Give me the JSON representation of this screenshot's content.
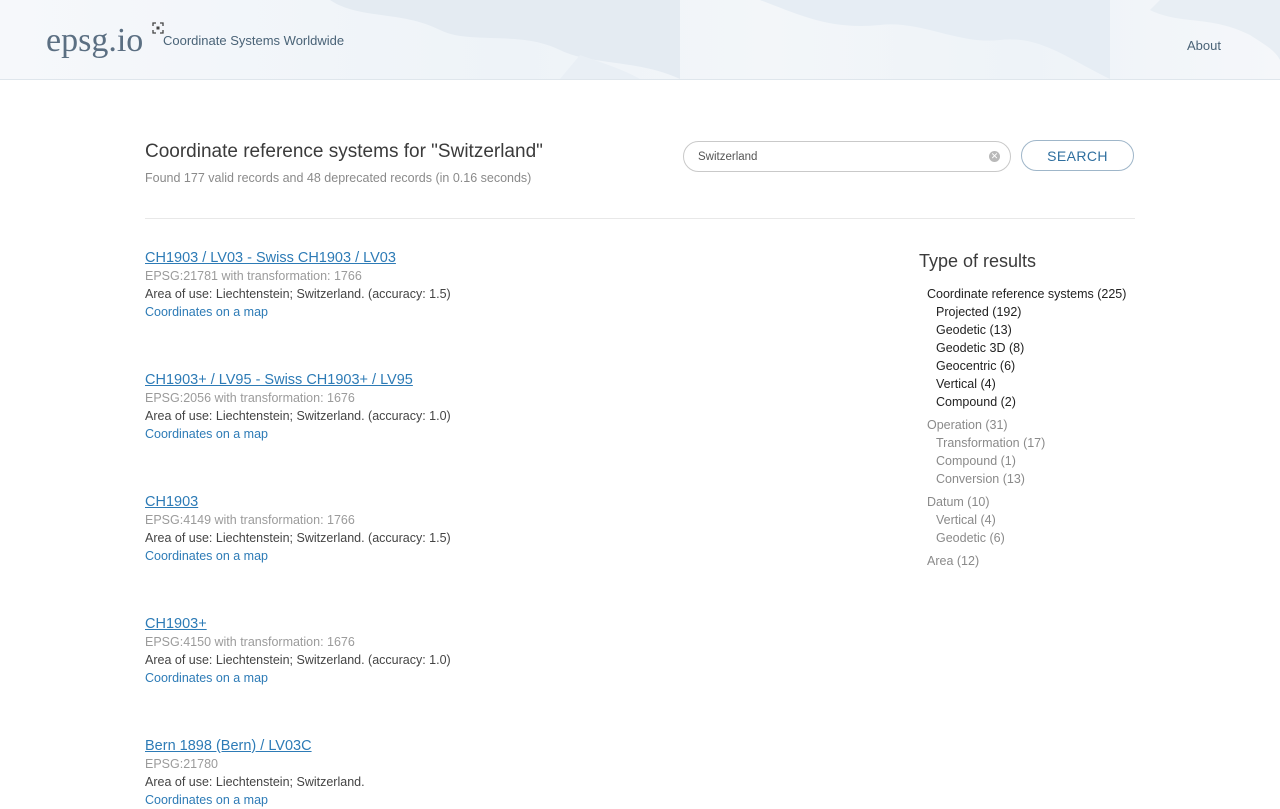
{
  "header": {
    "logo": "epsg.io",
    "tagline": "Coordinate Systems Worldwide",
    "about_label": "About"
  },
  "search": {
    "title": "Coordinate reference systems for \"Switzerland\"",
    "summary": "Found 177 valid records and 48 deprecated records (in 0.16 seconds)",
    "query": "Switzerland",
    "button_label": "SEARCH"
  },
  "results": [
    {
      "title": "CH1903 / LV03 - Swiss CH1903 / LV03",
      "code": "EPSG:21781 with transformation: 1766",
      "area": "Area of use: Liechtenstein; Switzerland. (accuracy: 1.5)",
      "map_link": "Coordinates on a map"
    },
    {
      "title": "CH1903+ / LV95 - Swiss CH1903+ / LV95",
      "code": "EPSG:2056 with transformation: 1676",
      "area": "Area of use: Liechtenstein; Switzerland. (accuracy: 1.0)",
      "map_link": "Coordinates on a map"
    },
    {
      "title": "CH1903",
      "code": "EPSG:4149 with transformation: 1766",
      "area": "Area of use: Liechtenstein; Switzerland. (accuracy: 1.5)",
      "map_link": "Coordinates on a map"
    },
    {
      "title": "CH1903+",
      "code": "EPSG:4150 with transformation: 1676",
      "area": "Area of use: Liechtenstein; Switzerland. (accuracy: 1.0)",
      "map_link": "Coordinates on a map"
    },
    {
      "title": "Bern 1898 (Bern) / LV03C",
      "code": "EPSG:21780",
      "area": "Area of use: Liechtenstein; Switzerland.",
      "map_link": "Coordinates on a map"
    }
  ],
  "facets": {
    "title": "Type of results",
    "crs": {
      "label": "Coordinate reference systems (225)",
      "items": [
        "Projected (192)",
        "Geodetic (13)",
        "Geodetic 3D (8)",
        "Geocentric (6)",
        "Vertical (4)",
        "Compound (2)"
      ]
    },
    "operation": {
      "label": "Operation (31)",
      "items": [
        "Transformation (17)",
        "Compound (1)",
        "Conversion (13)"
      ]
    },
    "datum": {
      "label": "Datum (10)",
      "items": [
        "Vertical (4)",
        "Geodetic (6)"
      ]
    },
    "area": {
      "label": "Area (12)"
    }
  },
  "colors": {
    "link": "#2d7bb6",
    "muted": "#8a8a8a",
    "header_bg": "#eef3f8"
  }
}
